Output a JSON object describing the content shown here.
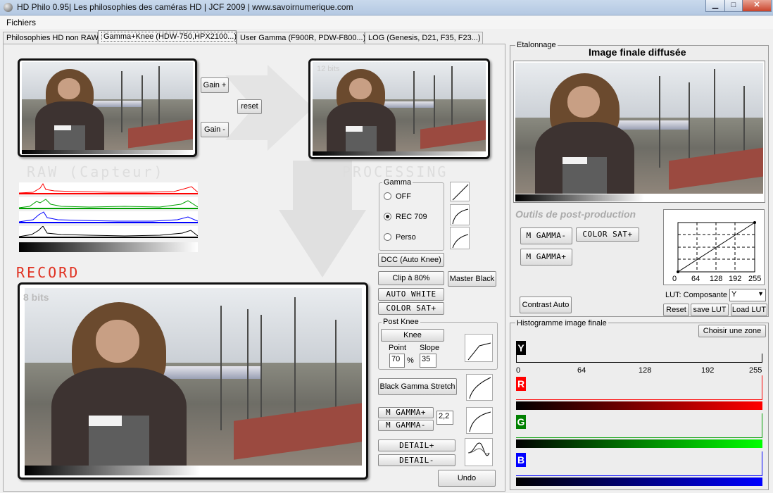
{
  "window": {
    "title": "HD Philo 0.95| Les philosophies des caméras HD | JCF 2009 | www.savoirnumerique.com",
    "min": "▁",
    "max": "□",
    "close": "✕"
  },
  "menu": {
    "fichiers": "Fichiers"
  },
  "tabs": [
    {
      "label": "Philosophies HD non RAW"
    },
    {
      "label": "Gamma+Knee (HDW-750,HPX2100...)"
    },
    {
      "label": "User Gamma (F900R, PDW-F800...)"
    },
    {
      "label": "LOG (Genesis, D21, F35, F23...)"
    }
  ],
  "raw": {
    "gain_plus": "Gain +",
    "gain_minus": "Gain -",
    "reset": "reset",
    "label": "RAW (Capteur)"
  },
  "processing": {
    "bits": "12 bits",
    "label": "PROCESSING"
  },
  "record": {
    "label": "RECORD",
    "bits": "8 bits"
  },
  "gamma": {
    "title": "Gamma",
    "off": "OFF",
    "rec709": "REC 709",
    "perso": "Perso",
    "selected": "REC 709"
  },
  "controls": {
    "dcc": "DCC (Auto Knee)",
    "clip": "Clip à 80%",
    "master_black": "Master Black",
    "auto_white": "AUTO WHITE",
    "color_sat": "COLOR SAT+",
    "post_knee": "Post Knee",
    "knee": "Knee",
    "point_label": "Point",
    "slope_label": "Slope",
    "point_value": "70",
    "percent": "%",
    "slope_value": "35",
    "black_gamma_stretch": "Black Gamma Stretch",
    "m_gamma_plus": "M GAMMA+",
    "m_gamma_minus": "M GAMMA-",
    "gamma_value": "2,2",
    "detail_plus": "DETAIL+",
    "detail_minus": "DETAIL-",
    "undo": "Undo"
  },
  "etalonnage": {
    "group_label": "Etalonnage",
    "title": "Image finale diffusée",
    "tools_label": "Outils de post-production",
    "m_gamma_minus": "M GAMMA-",
    "m_gamma_plus": "M GAMMA+",
    "color_sat": "COLOR SAT+",
    "contrast_auto": "Contrast Auto",
    "lut_label": "LUT: Composante",
    "lut_value": "Y",
    "lut_ticks": [
      "0",
      "64",
      "128",
      "192",
      "255"
    ],
    "reset": "Reset",
    "save_lut": "save LUT",
    "load_lut": "Load LUT"
  },
  "final_histogram": {
    "title": "Histogramme image finale",
    "choose_zone": "Choisir une zone",
    "channels": [
      "Y",
      "R",
      "G",
      "B"
    ],
    "ticks": [
      "0",
      "64",
      "128",
      "192",
      "255"
    ]
  },
  "colors": {
    "red": "#ff0000",
    "green": "#00c000",
    "blue": "#0000ff",
    "record_label": "#e03020"
  }
}
